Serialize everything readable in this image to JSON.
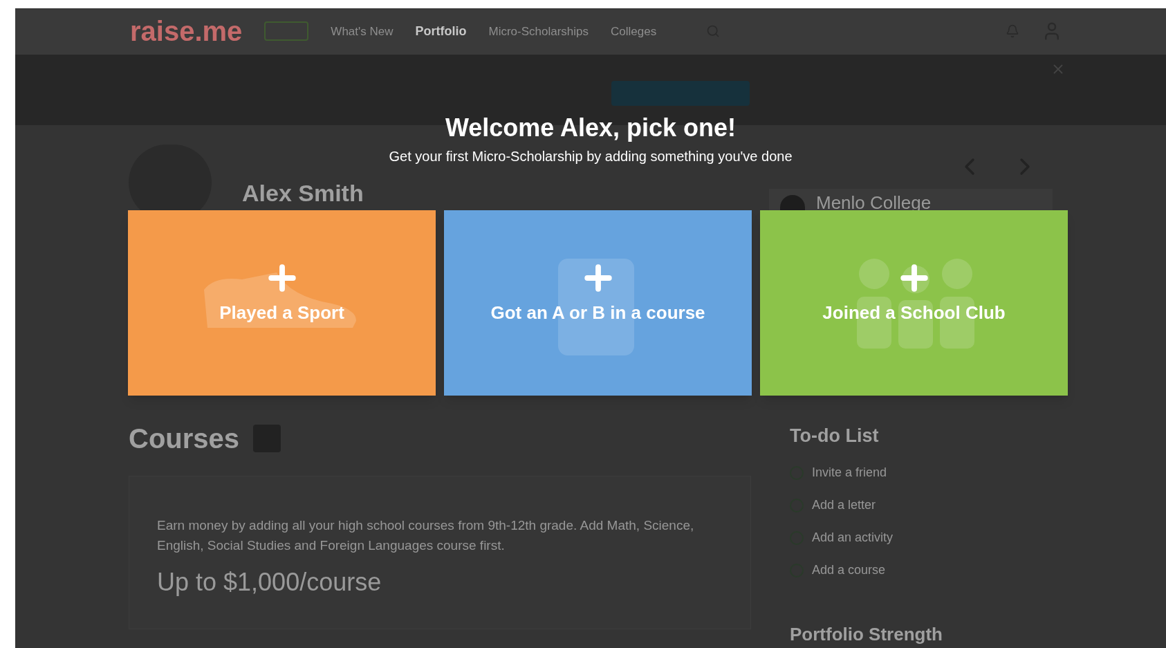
{
  "nav": {
    "logo": "raise.me",
    "items": [
      {
        "label": "What's New",
        "selected": false
      },
      {
        "label": "Portfolio",
        "selected": true
      },
      {
        "label": "Micro-Scholarships",
        "selected": false
      },
      {
        "label": "Colleges",
        "selected": false
      }
    ]
  },
  "modal": {
    "title": "Welcome Alex, pick one!",
    "subtitle": "Get your first Micro-Scholarship by adding something you've done",
    "options": [
      {
        "kind": "sport",
        "label": "Played a Sport",
        "color": "#f49a4a"
      },
      {
        "kind": "course",
        "label": "Got an A or B in a course",
        "color": "#66a3de"
      },
      {
        "kind": "club",
        "label": "Joined a School Club",
        "color": "#8cc34a"
      }
    ]
  },
  "profile": {
    "name": "Alex Smith",
    "college": "Menlo College"
  },
  "courses": {
    "title": "Courses",
    "description": "Earn money by adding all your high school courses from 9th-12th grade. Add Math, Science, English, Social Studies and Foreign Languages course first.",
    "amount": "Up to $1,000/course"
  },
  "todo": {
    "title": "To-do List",
    "items": [
      "Invite a friend",
      "Add a letter",
      "Add an activity",
      "Add a course"
    ]
  },
  "portfolio_strength": {
    "title": "Portfolio Strength"
  }
}
